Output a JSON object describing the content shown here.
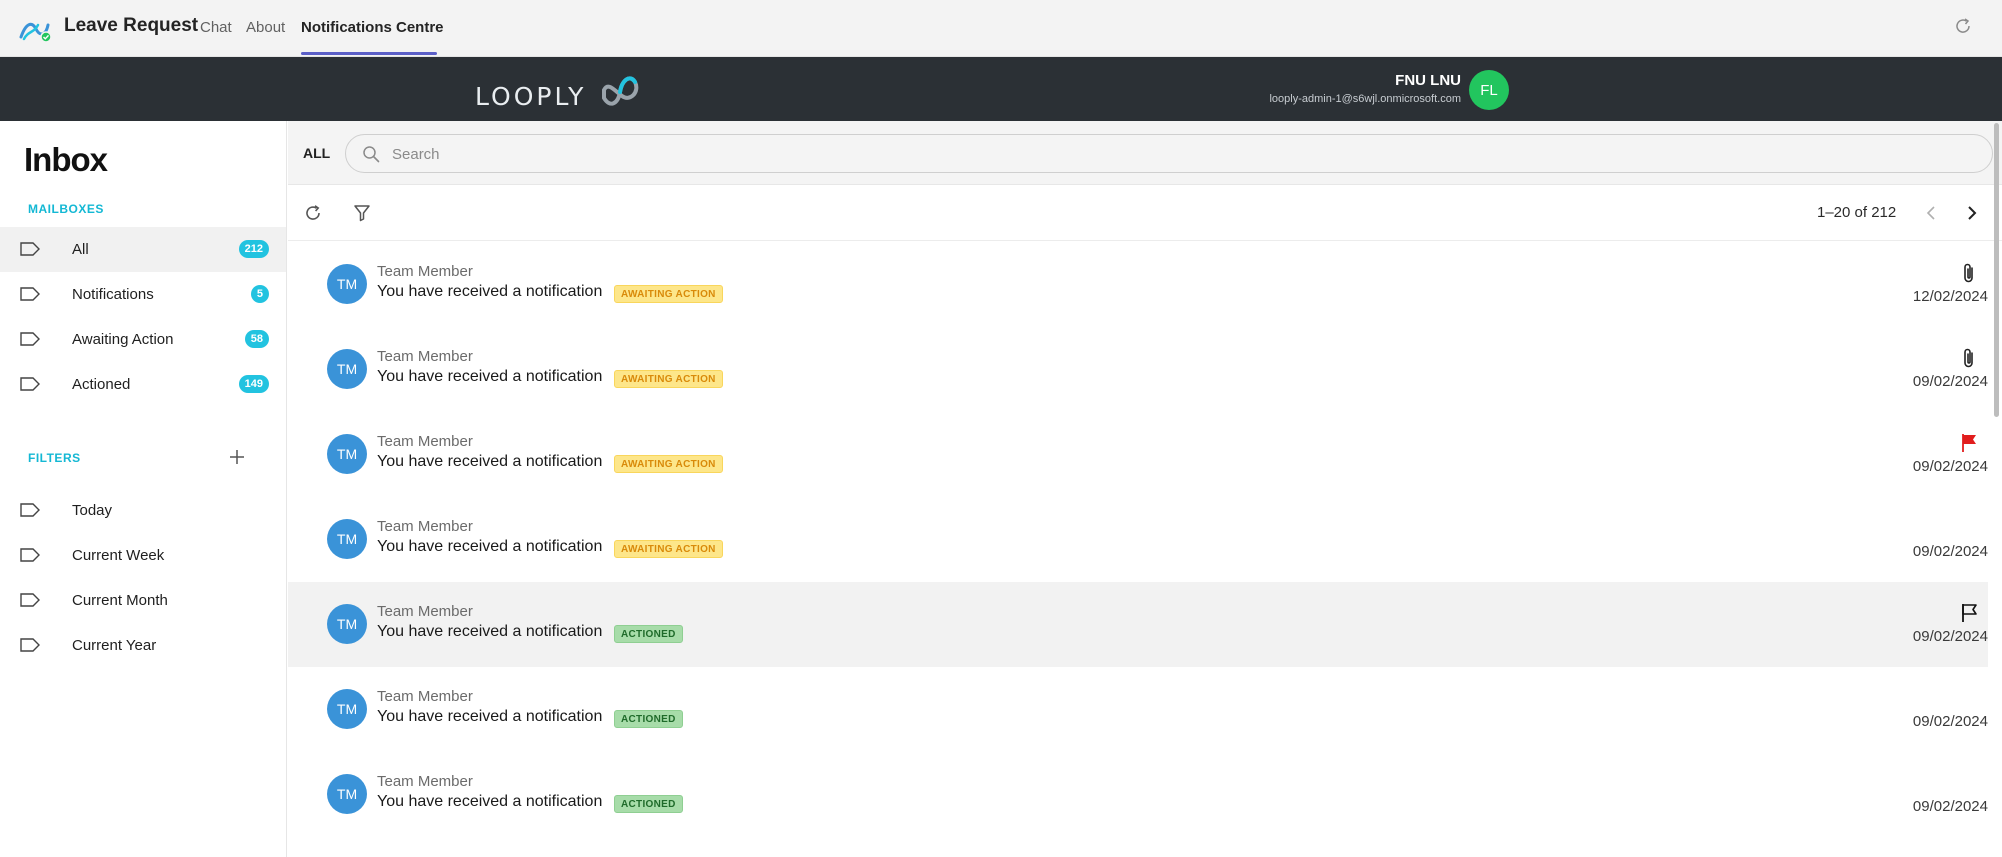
{
  "app": {
    "title": "Leave Request",
    "tabs": [
      {
        "label": "Chat"
      },
      {
        "label": "About"
      },
      {
        "label": "Notifications Centre"
      }
    ],
    "active_tab": "Notifications Centre",
    "accent_color": "#5b5fc7"
  },
  "brand": {
    "wordmark": "LOOPLY",
    "header_bg": "#2b3035"
  },
  "user": {
    "name": "FNU LNU",
    "email": "looply-admin-1@s6wjl.onmicrosoft.com",
    "initials": "FL",
    "avatar_color": "#22c55e"
  },
  "sidebar": {
    "title": "Inbox",
    "mailboxes_label": "MAILBOXES",
    "mailboxes": [
      {
        "label": "All",
        "count": "212",
        "active": true
      },
      {
        "label": "Notifications",
        "count": "5",
        "active": false
      },
      {
        "label": "Awaiting Action",
        "count": "58",
        "active": false
      },
      {
        "label": "Actioned",
        "count": "149",
        "active": false
      }
    ],
    "filters_label": "FILTERS",
    "filters": [
      {
        "label": "Today"
      },
      {
        "label": "Current Week"
      },
      {
        "label": "Current Month"
      },
      {
        "label": "Current Year"
      }
    ],
    "badge_color": "#22c3e0"
  },
  "search": {
    "scope": "ALL",
    "placeholder": "Search"
  },
  "toolbar": {
    "refresh_icon": "refresh-icon",
    "filter_icon": "filter-icon",
    "pagination": "1–20 of 212"
  },
  "messages": [
    {
      "sender": "Team Member",
      "initials": "TM",
      "subject": "You have received a notification",
      "status": "AWAITING ACTION",
      "status_type": "awaiting",
      "date": "12/02/2024",
      "icon": "paperclip-icon",
      "highlight": false
    },
    {
      "sender": "Team Member",
      "initials": "TM",
      "subject": "You have received a notification",
      "status": "AWAITING ACTION",
      "status_type": "awaiting",
      "date": "09/02/2024",
      "icon": "paperclip-icon",
      "highlight": false
    },
    {
      "sender": "Team Member",
      "initials": "TM",
      "subject": "You have received a notification",
      "status": "AWAITING ACTION",
      "status_type": "awaiting",
      "date": "09/02/2024",
      "icon": "flag-filled-icon",
      "highlight": false
    },
    {
      "sender": "Team Member",
      "initials": "TM",
      "subject": "You have received a notification",
      "status": "AWAITING ACTION",
      "status_type": "awaiting",
      "date": "09/02/2024",
      "icon": "",
      "highlight": false
    },
    {
      "sender": "Team Member",
      "initials": "TM",
      "subject": "You have received a notification",
      "status": "ACTIONED",
      "status_type": "actioned",
      "date": "09/02/2024",
      "icon": "flag-outline-icon",
      "highlight": true
    },
    {
      "sender": "Team Member",
      "initials": "TM",
      "subject": "You have received a notification",
      "status": "ACTIONED",
      "status_type": "actioned",
      "date": "09/02/2024",
      "icon": "",
      "highlight": false
    },
    {
      "sender": "Team Member",
      "initials": "TM",
      "subject": "You have received a notification",
      "status": "ACTIONED",
      "status_type": "actioned",
      "date": "09/02/2024",
      "icon": "",
      "highlight": false
    }
  ],
  "colors": {
    "avatar": "#3a93d8",
    "flag_red": "#e11d1d",
    "awaiting_bg": "#fde68a",
    "actioned_bg": "#a7dca9"
  }
}
